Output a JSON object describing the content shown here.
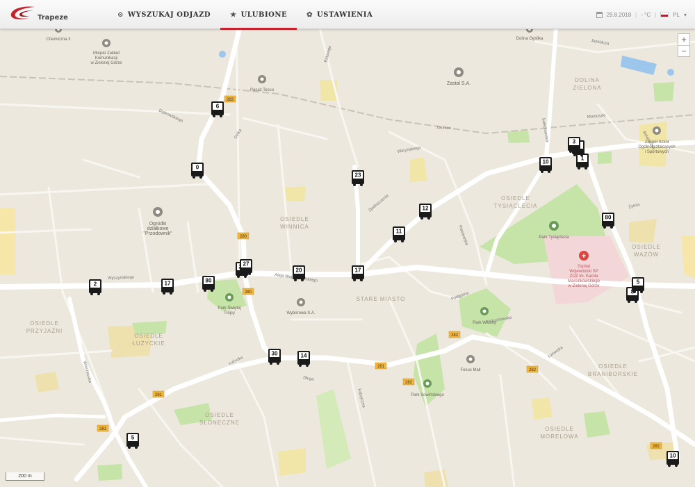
{
  "header": {
    "logo_text": "Trapeze",
    "nav": [
      {
        "label": "WYSZUKAJ ODJAZD",
        "icon": "search-icon"
      },
      {
        "label": "ULUBIONE",
        "icon": "star-icon"
      },
      {
        "label": "USTAWIENIA",
        "icon": "gear-icon"
      }
    ],
    "date": "29.8.2018",
    "temperature": "- °C",
    "language": "PL"
  },
  "map": {
    "scale_label": "200 m",
    "districts": [
      {
        "name": "DOLINA\nZIELONA"
      },
      {
        "name": "OSIEDLE\nTYSIĄCLECIA"
      },
      {
        "name": "OSIEDLE\nWINNICA"
      },
      {
        "name": "OSIEDLE\nWAZÓW"
      },
      {
        "name": "STARE MIASTO"
      },
      {
        "name": "OSIEDLE\nPRZYJAŹNI"
      },
      {
        "name": "OSIEDLE\nŁUŻYCKIE"
      },
      {
        "name": "OSIEDLE\nBRANIBORSKIE"
      },
      {
        "name": "OSIEDLE\nSŁONECZNE"
      },
      {
        "name": "OSIEDLE\nMORELOWA"
      }
    ],
    "pois": [
      {
        "name": "Miejski Zakład\nKomunikacji\nw Zielonej Górze"
      },
      {
        "name": "Zastal S.A."
      },
      {
        "name": "Pasaż Tesco"
      },
      {
        "name": "Ogródki\ndziałkowe\n\"Przodownik\""
      },
      {
        "name": "Park Tysiąclecia"
      },
      {
        "name": "Szpital\nWojewódzki SP\nZOZ im. Karola\nMarcinkowskiego\nw Zielonej Górze"
      },
      {
        "name": "Park Świętej\nTrójcy"
      },
      {
        "name": "Wyborowa S.A."
      },
      {
        "name": "Park Wiosny"
      },
      {
        "name": "Focus Mall"
      },
      {
        "name": "Park Sowińskiego"
      },
      {
        "name": "Zespół Szkół\nOgólnokształcących\ni Sportowych"
      },
      {
        "name": "Chemiczna 3"
      },
      {
        "name": "Dolina Gęślika"
      }
    ],
    "streets": [
      {
        "name": "Dąbrowskiego"
      },
      {
        "name": "Dzika"
      },
      {
        "name": "Batorego"
      },
      {
        "name": "Aleja Wojska Polskiego"
      },
      {
        "name": "Łużycka"
      },
      {
        "name": "Wyszyńskiego"
      },
      {
        "name": "Zjednoczenia"
      },
      {
        "name": "Waryńskiego"
      },
      {
        "name": "Zacisze"
      },
      {
        "name": "Podgórna"
      },
      {
        "name": "Fabryczna"
      },
      {
        "name": "Lwowska"
      },
      {
        "name": "Piastowska"
      },
      {
        "name": "Sulechowska"
      },
      {
        "name": "Wrocławska"
      },
      {
        "name": "Moniuszki"
      },
      {
        "name": "Kożuchowska"
      },
      {
        "name": "Długa"
      },
      {
        "name": "Jaskółcza"
      },
      {
        "name": "Botaniczna"
      },
      {
        "name": "Żytnia"
      }
    ],
    "road_badges": [
      "283",
      "280",
      "280",
      "281",
      "282",
      "282",
      "282",
      "281",
      "281",
      "282",
      "283"
    ],
    "buses": [
      "6",
      "0",
      "23",
      "12",
      "11",
      "17",
      "29",
      "27",
      "20",
      "2",
      "17",
      "80",
      "30",
      "14",
      "5",
      "10",
      "1",
      "10",
      "7",
      "3",
      "80",
      "8",
      "5"
    ]
  },
  "colors": {
    "accent": "#c3232c",
    "map_bg": "#ece8dd",
    "park": "#c6e3a8",
    "road_major": "#ffffff",
    "highway_badge": "#f2b63d",
    "hospital": "#f3d6d8",
    "water": "#9cc6ec",
    "district_label": "#a89e8c"
  }
}
